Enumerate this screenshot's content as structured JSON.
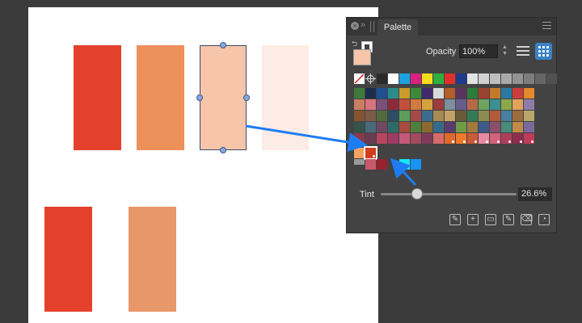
{
  "canvas": {
    "swatch_colors": [
      "#e3412b",
      "#ee905a",
      "#f6c5aa",
      "#fdece5",
      "#e3412b",
      "#e8976a"
    ]
  },
  "palette_panel": {
    "tab_label": "Palette",
    "opacity_label": "Opacity",
    "opacity_value": "100%",
    "tint_label": "Tint",
    "tint_value": "26.6%",
    "tint_level": 0.266,
    "fill_color": "#f6c5aa",
    "view_mode": "grid",
    "swatches": {
      "row1": [
        "#2a2a2a",
        "#ffffff",
        "#1fa1e0",
        "#d9217f",
        "#f5dc1e",
        "#2fae3c",
        "#e0302b",
        "#1f3a8a",
        "#e3e3e3",
        "#d1d1d1",
        "#bdbdbd",
        "#a9a9a9",
        "#939393",
        "#7d7d7d",
        "#666666",
        "#515151"
      ],
      "rows": [
        [
          "#3d7a3b",
          "#1c2e4a",
          "#1d4f91",
          "#2c8c8c",
          "#cb9c2a",
          "#3d8a3b",
          "#3f2a6e",
          "#d9d9d9",
          "#b35d28",
          "#58345e",
          "#2b7c3a",
          "#9c4230",
          "#c47a2b",
          "#2a7aa2",
          "#cc3d39",
          "#e28a2a"
        ],
        [
          "#c97d63",
          "#d8747e",
          "#7a4f7a",
          "#8b2c3b",
          "#c3503d",
          "#d27a3e",
          "#d7a23e",
          "#9c3b3b",
          "#7b8f9c",
          "#6a5b8d",
          "#b46a47",
          "#6fa360",
          "#3a8f8f",
          "#8ba84a",
          "#e0a35c",
          "#8d7caa"
        ],
        [
          "#86532f",
          "#7b5b4a",
          "#536b3a",
          "#2c4d63",
          "#5a9e5a",
          "#a54a4a",
          "#3c6d91",
          "#a78b52",
          "#c4a267",
          "#6b5a3a",
          "#357a57",
          "#8c8c50",
          "#b25b3b",
          "#477ea1",
          "#9e6c3c",
          "#b9a46a"
        ],
        [
          "#35544a",
          "#4a6a7c",
          "#6e4a62",
          "#2e6a6a",
          "#a84a3d",
          "#4e7f3b",
          "#8b6a2e",
          "#356b8a",
          "#5a3d6e",
          "#6e9c4a",
          "#a07a40",
          "#3d5a8a",
          "#8a4f6e",
          "#4a8a7a",
          "#c08a4a",
          "#7a6a9c"
        ],
        [
          "#8a3a4a",
          "#6a3c52",
          "#b8455e",
          "#9c3b64",
          "#c45a7a",
          "#a34a5e",
          "#7e3a5a",
          "#d96a6a",
          "#e06a2a",
          "#f07a2a",
          "#c95a3a",
          "#e88aa0",
          "#d2617a",
          "#b13d5d",
          "#8e2d4d",
          "#c23a5a"
        ]
      ],
      "recent": [
        "#f5a25f",
        "#d33b1e",
        "#9a9a9a",
        "#c85a6a",
        "#9b2030",
        "#19e6ef",
        "#1993f5"
      ]
    }
  }
}
